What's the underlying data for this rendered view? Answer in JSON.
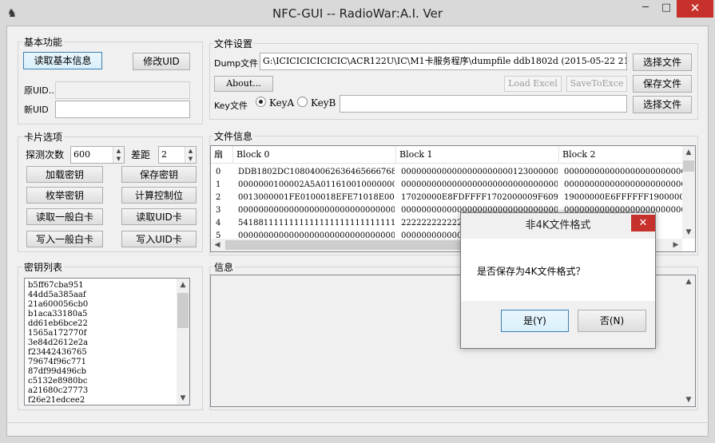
{
  "window": {
    "title": "NFC-GUI  -- RadioWar:A.I. Ver",
    "minimize": "─",
    "maximize": "□",
    "close": "✕"
  },
  "basic": {
    "group_label": "基本功能",
    "read_info_label": "读取基本信息",
    "modify_uid_label": "修改UID",
    "orig_uid_label": "原UID...",
    "orig_uid_value": "",
    "new_uid_label": "新UID",
    "new_uid_value": ""
  },
  "card_options": {
    "group_label": "卡片选项",
    "probe_count_label": "探测次数",
    "probe_count_value": "600",
    "gap_label": "差距",
    "gap_value": "2",
    "buttons": [
      "加载密钥",
      "保存密钥",
      "枚举密钥",
      "计算控制位",
      "读取一般白卡",
      "读取UID卡",
      "写入一般白卡",
      "写入UID卡"
    ]
  },
  "keys": {
    "group_label": "密钥列表",
    "items": [
      "b5ff67cba951",
      "44dd5a385aaf",
      "21a600056cb0",
      "b1aca33180a5",
      "dd61eb6bce22",
      "1565a172770f",
      "3e84d2612e2a",
      "f23442436765",
      "79674f96c771",
      "87df99d496cb",
      "c5132e8980bc",
      "a21680c27773",
      "f26e21edcee2"
    ]
  },
  "file_settings": {
    "group_label": "文件设置",
    "dump_label": "Dump文件",
    "dump_path": "G:\\ICICICICICICIC\\ACR122U\\IC\\M1卡服务程序\\dumpfile ddb1802d (2015-05-22 21_2",
    "select_file_label": "选择文件",
    "about_label": "About...",
    "load_excel_label": "Load Excel",
    "save_to_exce_label": "SaveToExce",
    "save_file_label": "保存文件",
    "key_file_label": "Key文件",
    "key_a_label": "KeyA",
    "key_b_label": "KeyB",
    "key_file_value": "",
    "select_key_file_label": "选择文件"
  },
  "file_info": {
    "group_label": "文件信息",
    "columns": [
      "扇",
      "Block 0",
      "Block 1",
      "Block 2"
    ],
    "rows": [
      [
        "0",
        "DDB1802DC108040062636465666768 69",
        "00000000000000000000001230000000",
        "00000000000000000000000000"
      ],
      [
        "1",
        "0000000100002A5A0116100100000000",
        "00000000000000000000000000000000",
        "00000000000000000000000000"
      ],
      [
        "2",
        "0013000001FE0100018EFE71018E0062",
        "17020000E8FDFFFF1702000009F609F6",
        "19000000E6FFFFFF19000000"
      ],
      [
        "3",
        "00000000000000000000000000000000",
        "00000000000000000000000000000000",
        "00000000000000000000000000"
      ],
      [
        "4",
        "54188111111111111111111111111111",
        "2222222222222",
        "3333"
      ],
      [
        "5",
        "00000000000000000000000000000000",
        "00000000000000",
        "000000"
      ]
    ]
  },
  "info": {
    "group_label": "信息"
  },
  "dialog": {
    "title": "非4K文件格式",
    "message": "是否保存为4K文件格式？",
    "yes_label": "是(Y)",
    "no_label": "否(N)",
    "close": "✕"
  },
  "colors": {
    "close_red": "#c7312b",
    "client_bg": "#f0f0f0",
    "focus_border": "#3c7fb1"
  }
}
